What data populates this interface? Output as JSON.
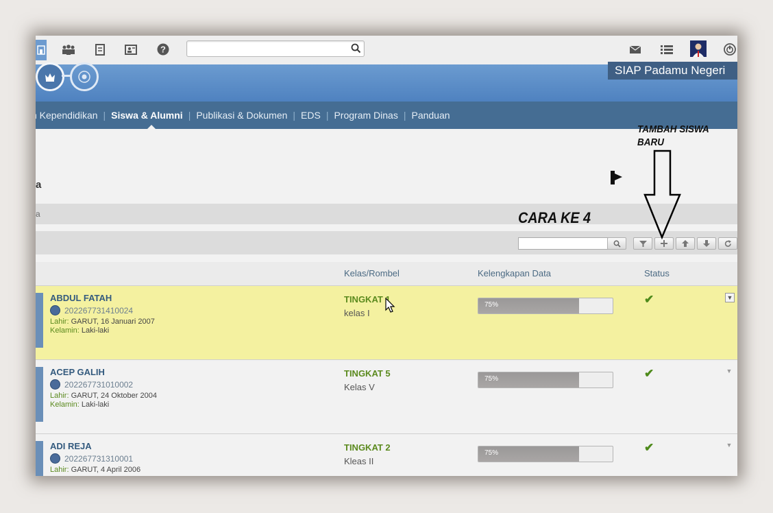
{
  "header": {
    "brand": "SIAP Padamu Negeri"
  },
  "nav": {
    "items": [
      "n Kependidikan",
      "Siswa & Alumni",
      "Publikasi & Dokumen",
      "EDS",
      "Program Dinas",
      "Panduan"
    ],
    "active_index": 1
  },
  "page": {
    "title_fragment": "a",
    "breadcrumb_fragment": "a"
  },
  "grid": {
    "search_value": "",
    "columns": {
      "kelas": "Kelas/Rombel",
      "kelengkapan": "Kelengkapan Data",
      "status": "Status"
    },
    "label_lahir": "Lahir:",
    "label_kelamin": "Kelamin:",
    "rows": [
      {
        "name": "ABDUL FATAH",
        "nisn": "202267731410024",
        "lahir": "GARUT, 16 Januari 2007",
        "kelamin": "Laki-laki",
        "tingkat": "TINGKAT 1",
        "kelas": "kelas I",
        "progress_text": "75%",
        "progress": 0.75,
        "status": "✔"
      },
      {
        "name": "ACEP GALIH",
        "nisn": "202267731010002",
        "lahir": "GARUT, 24 Oktober 2004",
        "kelamin": "Laki-laki",
        "tingkat": "TINGKAT 5",
        "kelas": "Kelas V",
        "progress_text": "75%",
        "progress": 0.75,
        "status": "✔"
      },
      {
        "name": "ADI REJA",
        "nisn": "202267731310001",
        "lahir": "GARUT, 4 April 2006",
        "kelamin": "",
        "tingkat": "TINGKAT 2",
        "kelas": "Kleas II",
        "progress_text": "75%",
        "progress": 0.75,
        "status": "✔"
      }
    ]
  },
  "annotations": {
    "cara": "CARA KE 4",
    "tambah": "TAMBAH SISWA BARU"
  },
  "colors": {
    "header_blue": "#5b8dc7",
    "nav_blue": "#456d93",
    "highlight_row": "#f4f1a0",
    "green_text": "#5b8a1e"
  },
  "icons": [
    "school-icon",
    "group-icon",
    "document-icon",
    "contact-card-icon",
    "help-icon",
    "search-icon",
    "mail-icon",
    "list-icon",
    "power-icon",
    "crown-icon",
    "emblem-icon",
    "filter-icon",
    "plus-icon",
    "arrow-up-icon",
    "arrow-down-icon",
    "refresh-icon",
    "check-icon",
    "chevron-down-icon",
    "cursor-icon"
  ]
}
